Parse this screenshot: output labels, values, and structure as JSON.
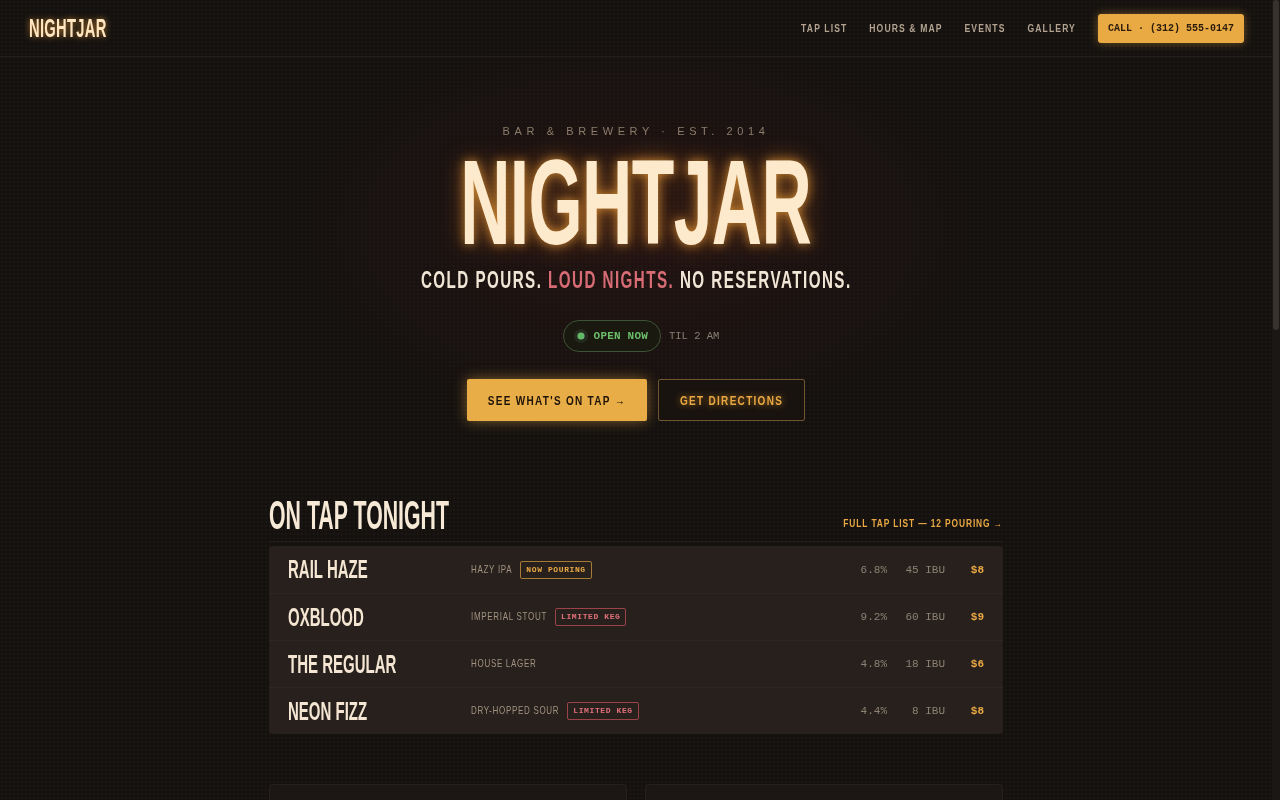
{
  "nav": {
    "logo": "NIGHTJAR",
    "links": [
      "TAP LIST",
      "HOURS & MAP",
      "EVENTS",
      "GALLERY"
    ],
    "call_button": "CALL · (312) 555-0147"
  },
  "hero": {
    "eyebrow": "BAR & BREWERY · EST. 2014",
    "title": "NIGHTJAR",
    "tagline": [
      {
        "text": "COLD POURS.",
        "highlight": false
      },
      {
        "text": "LOUD NIGHTS.",
        "highlight": true
      },
      {
        "text": "NO RESERVATIONS.",
        "highlight": false
      }
    ],
    "status": {
      "open": true,
      "label": "OPEN NOW",
      "note": "TIL 2 AM"
    },
    "buttons": [
      {
        "label": "SEE WHAT'S ON TAP →",
        "kind": "primary"
      },
      {
        "label": "GET DIRECTIONS",
        "kind": "outline"
      }
    ]
  },
  "on_tap": {
    "title": "ON TAP TONIGHT",
    "link": "FULL TAP LIST — 12 POURING →",
    "beers": [
      {
        "name": "RAIL HAZE",
        "style": "HAZY IPA",
        "badge": {
          "label": "NOW POURING",
          "kind": "pouring"
        },
        "abv": "6.8%",
        "ibu": "45 IBU",
        "price": "$8"
      },
      {
        "name": "OXBLOOD",
        "style": "IMPERIAL STOUT",
        "badge": {
          "label": "LIMITED KEG",
          "kind": "limited"
        },
        "abv": "9.2%",
        "ibu": "60 IBU",
        "price": "$9"
      },
      {
        "name": "THE REGULAR",
        "style": "HOUSE LAGER",
        "abv": "4.8%",
        "ibu": "18 IBU",
        "price": "$6"
      },
      {
        "name": "NEON FIZZ",
        "style": "DRY-HOPPED SOUR",
        "badge": {
          "label": "LIMITED KEG",
          "kind": "limited"
        },
        "abv": "4.4%",
        "ibu": "8 IBU",
        "price": "$8"
      }
    ]
  }
}
